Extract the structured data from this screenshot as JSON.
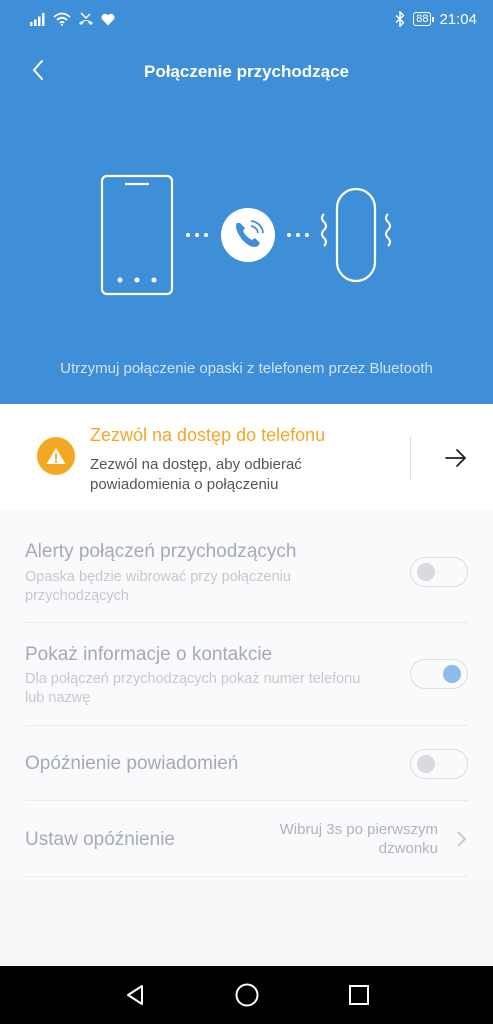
{
  "status_bar": {
    "battery": "88",
    "time": "21:04",
    "icons": [
      "signal-icon",
      "wifi-icon",
      "missed-call-icon",
      "heart-icon",
      "bluetooth-icon"
    ]
  },
  "header": {
    "title": "Połączenie przychodzące",
    "caption": "Utrzymuj połączenie opaski z telefonem przez Bluetooth"
  },
  "permission": {
    "title": "Zezwól na dostęp do telefonu",
    "description": "Zezwól na dostęp, aby odbierać powiadomienia o połączeniu"
  },
  "settings": [
    {
      "title": "Alerty połączeń przychodzących",
      "description": "Opaska będzie wibrować przy połączeniu przychodzących",
      "toggle": false
    },
    {
      "title": "Pokaż informacje o kontakcie",
      "description": "Dla połączeń przychodzących pokaż numer telefonu lub nazwę",
      "toggle": true
    },
    {
      "title": "Opóźnienie powiadomień",
      "toggle": false
    },
    {
      "title": "Ustaw opóźnienie",
      "value": "Wibruj 3s po pierwszym dzwonku"
    }
  ],
  "colors": {
    "primary": "#3e8fd8",
    "warning": "#f5a623",
    "toggle_on": "#8cbcea"
  }
}
